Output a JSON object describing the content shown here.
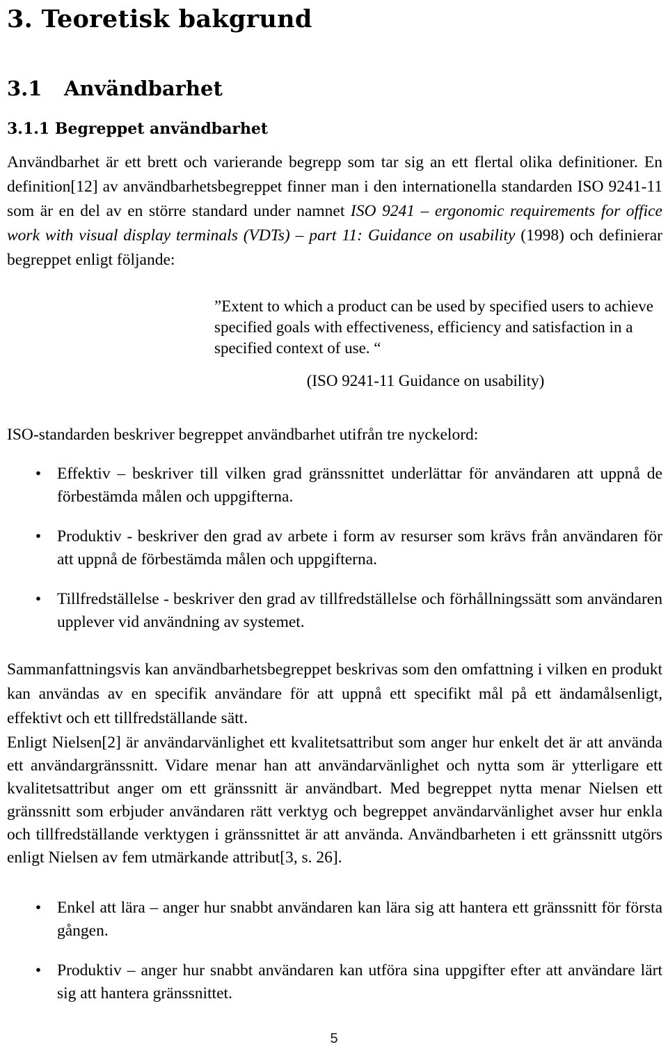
{
  "document": {
    "chapter_heading": "3. Teoretisk bakgrund",
    "section": {
      "number": "3.1",
      "title": "Användbarhet"
    },
    "subsection": {
      "heading": "3.1.1 Begreppet användbarhet"
    }
  },
  "paragraphs": {
    "intro_part1": "Användbarhet är ett brett och varierande begrepp som tar sig an ett flertal olika definitioner. En definition[12] av användbarhetsbegreppet finner man i den internationella standarden ISO 9241-11 som är en del av en större standard under namnet ",
    "intro_italic": "ISO 9241 – ergonomic requirements for office work with visual display terminals (VDTs) – part 11: Guidance on usability",
    "intro_part2": " (1998) och definierar begreppet enligt följande:",
    "keywords_lead": "ISO-standarden beskriver begreppet användbarhet utifrån tre nyckelord:",
    "summary": "Sammanfattningsvis kan användbarhetsbegreppet beskrivas som den omfattning i vilken en produkt kan användas av en specifik användare för att uppnå ett specifikt mål på ett ändamålsenligt, effektivt och ett tillfredställande sätt.",
    "nielsen": "Enligt Nielsen[2] är användarvänlighet ett kvalitetsattribut som anger hur enkelt det är att använda ett användargränssnitt. Vidare menar han att användarvänlighet och nytta som är ytterligare ett kvalitetsattribut anger om ett gränssnitt är användbart. Med begreppet nytta menar Nielsen ett gränssnitt som erbjuder användaren rätt verktyg och begreppet användarvänlighet avser hur enkla och tillfredställande verktygen i gränssnittet är att använda. Användbarheten i ett gränssnitt utgörs enligt Nielsen av fem utmärkande attribut[3, s. 26]."
  },
  "quote": {
    "text": "”Extent to which a product can be used by specified users to achieve specified goals with effectiveness, efficiency and satisfaction in a specified context of use. “",
    "source": "(ISO 9241-11 Guidance on usability)"
  },
  "keyword_list": {
    "bullet_glyph": "•",
    "items": [
      "Effektiv – beskriver till vilken grad gränssnittet underlättar för användaren att uppnå de förbestämda målen och uppgifterna.",
      "Produktiv - beskriver den grad av arbete i form av resurser som krävs från användaren för att uppnå de förbestämda målen och uppgifterna.",
      "Tillfredställelse - beskriver den grad av tillfredställelse och förhållningssätt som användaren upplever vid användning av systemet."
    ]
  },
  "attribute_list": {
    "bullet_glyph": "•",
    "items": [
      "Enkel att lära – anger hur snabbt användaren kan lära sig att hantera ett gränssnitt för första gången.",
      "Produktiv – anger hur snabbt användaren kan utföra sina uppgifter efter att användare lärt sig att hantera gränssnittet."
    ]
  },
  "footer": {
    "page_number": "5"
  }
}
